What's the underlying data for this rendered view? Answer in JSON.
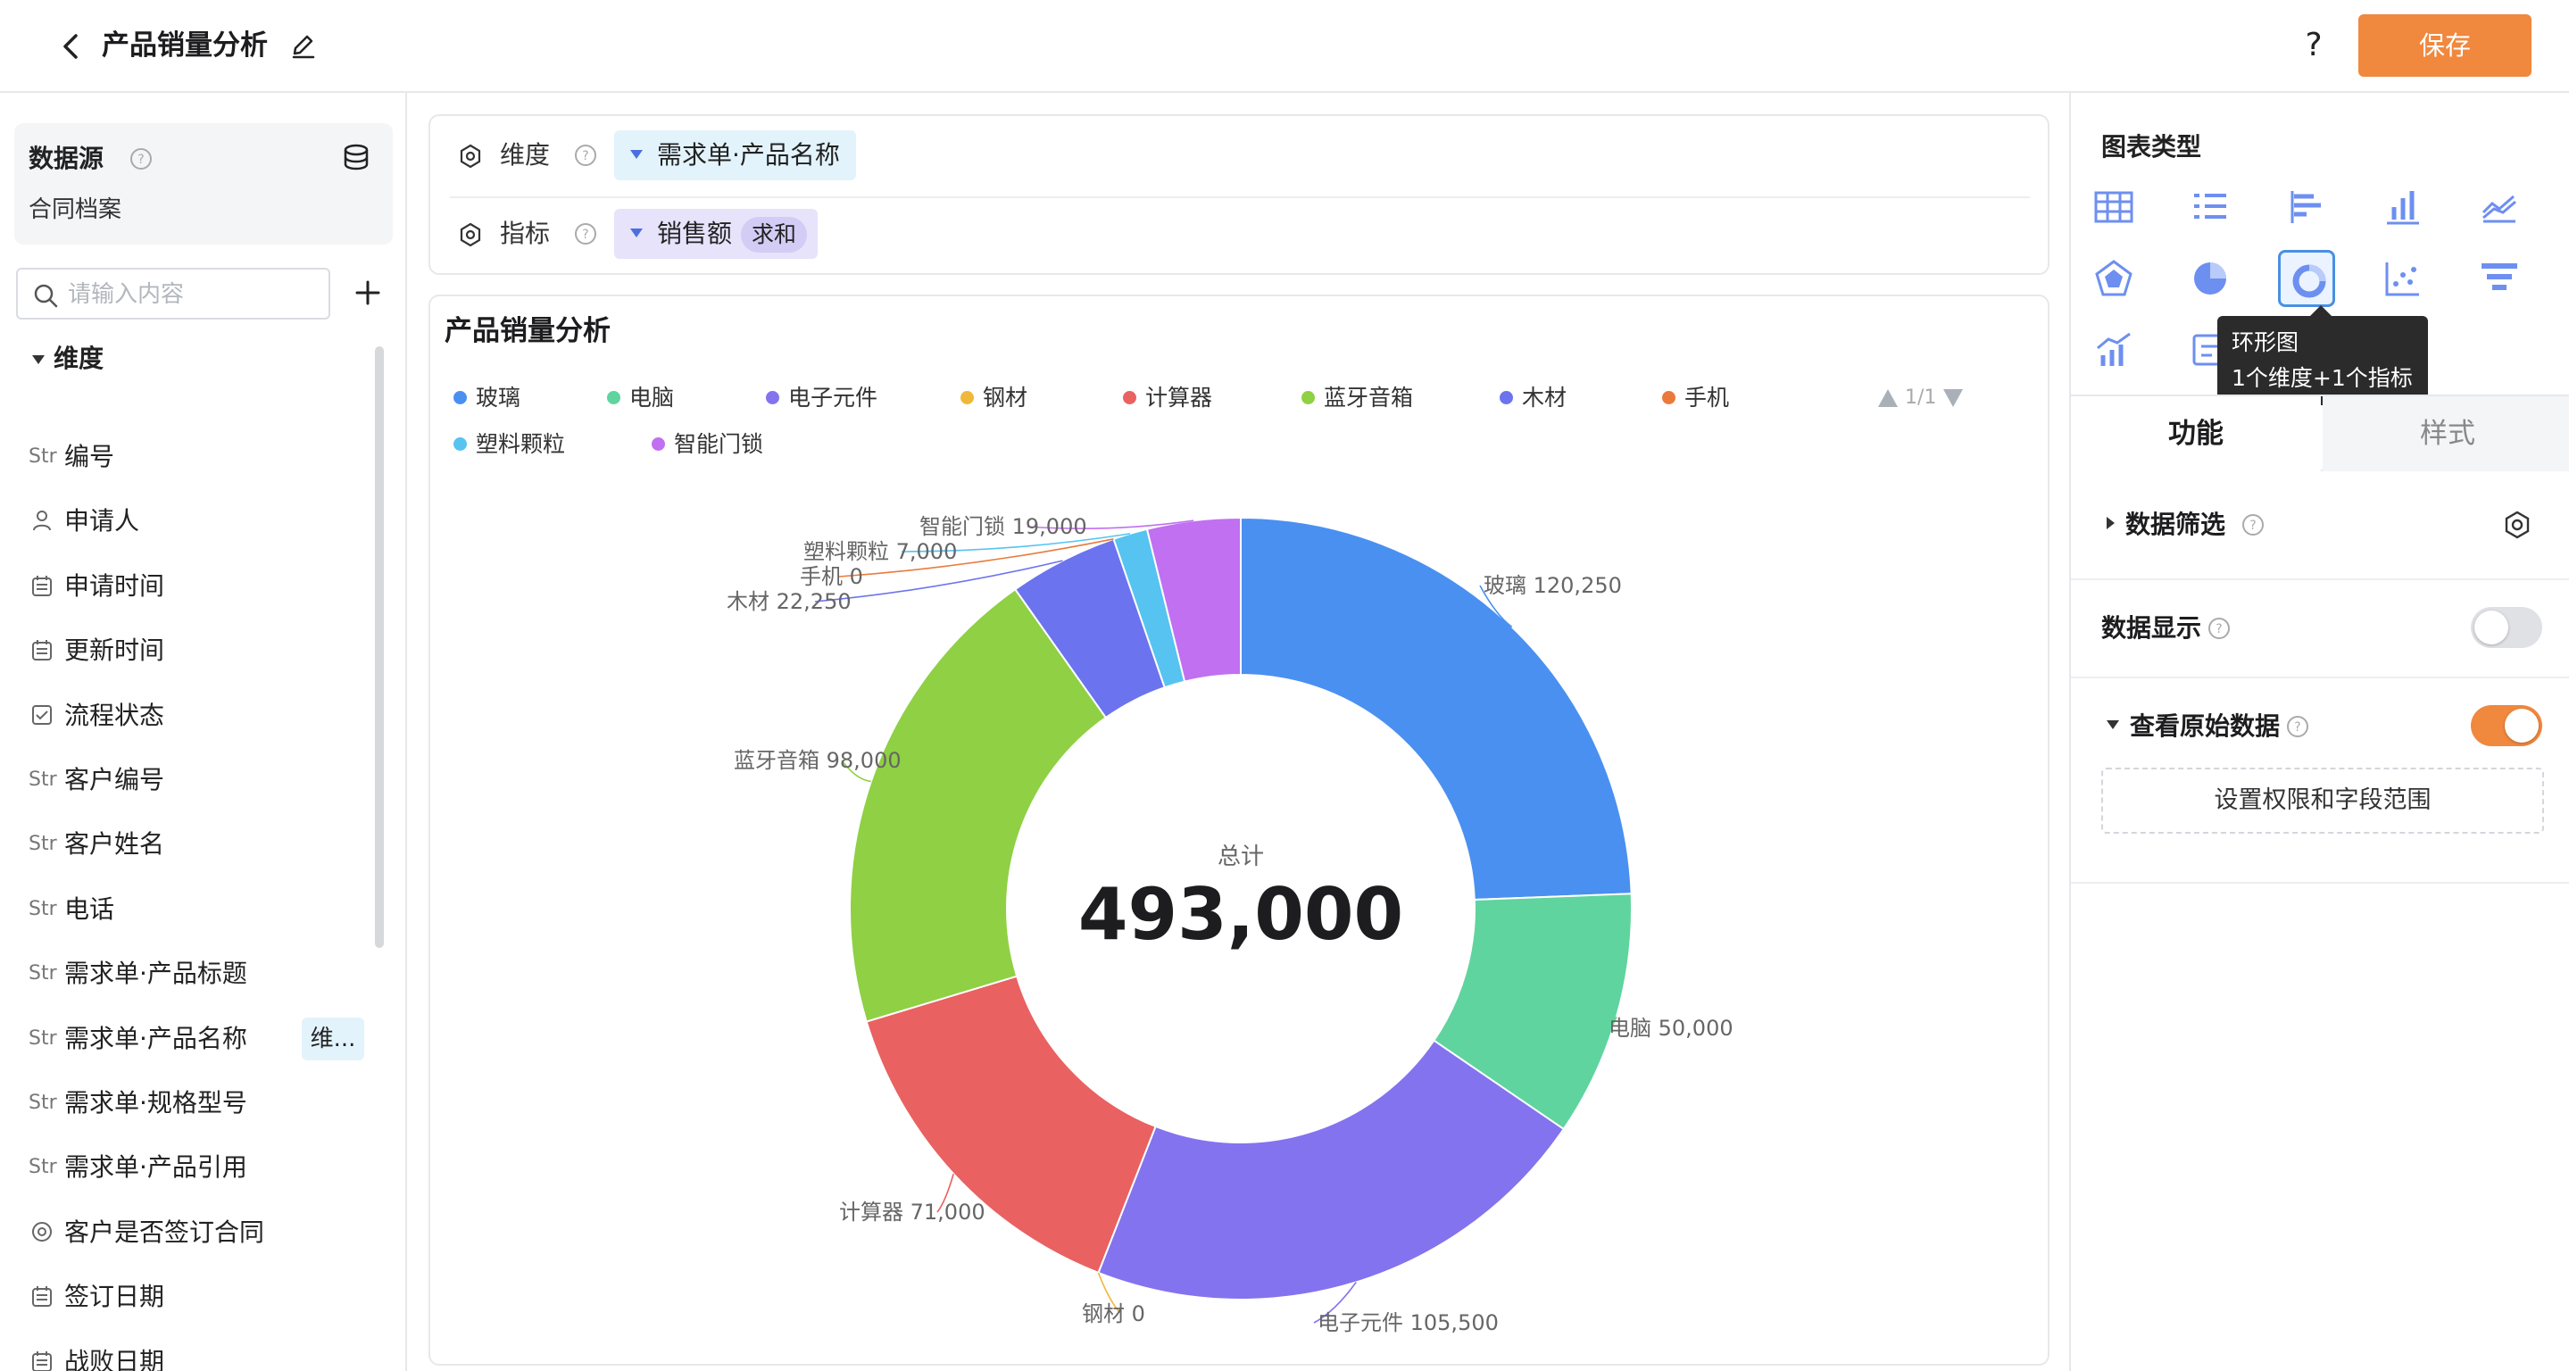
{
  "header": {
    "title": "产品销量分析",
    "help_label": "?",
    "save_label": "保存"
  },
  "datasource": {
    "title": "数据源",
    "name": "合同档案"
  },
  "search": {
    "placeholder": "请输入内容"
  },
  "dimension_group": {
    "title": "维度",
    "fields": [
      {
        "type": "Str",
        "icon": "text-type-icon",
        "label": "编号"
      },
      {
        "type": "user",
        "icon": "person-icon",
        "label": "申请人"
      },
      {
        "type": "date",
        "icon": "calendar-icon",
        "label": "申请时间"
      },
      {
        "type": "date",
        "icon": "calendar-icon",
        "label": "更新时间"
      },
      {
        "type": "check",
        "icon": "checkbox-icon",
        "label": "流程状态"
      },
      {
        "type": "Str",
        "icon": "text-type-icon",
        "label": "客户编号"
      },
      {
        "type": "Str",
        "icon": "text-type-icon",
        "label": "客户姓名"
      },
      {
        "type": "Str",
        "icon": "text-type-icon",
        "label": "电话"
      },
      {
        "type": "Str",
        "icon": "text-type-icon",
        "label": "需求单·产品标题"
      },
      {
        "type": "Str",
        "icon": "text-type-icon",
        "label": "需求单·产品名称",
        "tag": "维..."
      },
      {
        "type": "Str",
        "icon": "text-type-icon",
        "label": "需求单·规格型号"
      },
      {
        "type": "Str",
        "icon": "text-type-icon",
        "label": "需求单·产品引用"
      },
      {
        "type": "radio",
        "icon": "radio-icon",
        "label": "客户是否签订合同"
      },
      {
        "type": "date",
        "icon": "calendar-icon",
        "label": "签订日期"
      },
      {
        "type": "date",
        "icon": "calendar-icon",
        "label": "战败日期"
      }
    ]
  },
  "config": {
    "dimension_label": "维度",
    "dimension_value": "需求单·产品名称",
    "metric_label": "指标",
    "metric_value": "销售额",
    "metric_agg": "求和"
  },
  "chart_panel": {
    "title": "产品销量分析",
    "legend_page": "1/1"
  },
  "chart_data": {
    "type": "pie",
    "donut": true,
    "title": "产品销量分析",
    "center_label": "总计",
    "center_value": "493,000",
    "categories": [
      "玻璃",
      "电脑",
      "电子元件",
      "钢材",
      "计算器",
      "蓝牙音箱",
      "木材",
      "手机",
      "塑料颗粒",
      "智能门锁"
    ],
    "values": [
      120250,
      50000,
      105500,
      0,
      71000,
      98000,
      22250,
      0,
      7000,
      19000
    ],
    "data_labels": [
      "玻璃 120,250",
      "电脑 50,000",
      "电子元件 105,500",
      "钢材 0",
      "计算器 71,000",
      "蓝牙音箱 98,000",
      "木材 22,250",
      "手机 0",
      "塑料颗粒 7,000",
      "智能门锁 19,000"
    ],
    "colors": [
      "#4a90f0",
      "#5fd49e",
      "#8373ee",
      "#f0b83a",
      "#e96161",
      "#8fd044",
      "#6b73ee",
      "#ea7a3b",
      "#56c3f0",
      "#c070f0"
    ],
    "legend_position": "top"
  },
  "right_panel": {
    "chart_type_title": "图表类型",
    "chart_types": [
      {
        "name": "table",
        "icon": "table-icon"
      },
      {
        "name": "list",
        "icon": "list-icon"
      },
      {
        "name": "bar-horizontal",
        "icon": "bar-horizontal-icon"
      },
      {
        "name": "bar-vertical",
        "icon": "bar-vertical-icon"
      },
      {
        "name": "line",
        "icon": "line-chart-icon"
      },
      {
        "name": "radar",
        "icon": "radar-icon"
      },
      {
        "name": "pie",
        "icon": "pie-icon"
      },
      {
        "name": "donut",
        "icon": "donut-icon",
        "selected": true
      },
      {
        "name": "scatter",
        "icon": "scatter-icon"
      },
      {
        "name": "funnel",
        "icon": "funnel-icon"
      },
      {
        "name": "combo",
        "icon": "combo-chart-icon"
      },
      {
        "name": "indicator",
        "icon": "indicator-card-icon"
      },
      {
        "name": "map",
        "icon": "map-icon"
      },
      {
        "name": "tree",
        "icon": "tree-icon"
      }
    ],
    "tooltip_title": "环形图",
    "tooltip_desc": "1个维度+1个指标",
    "tab_function": "功能",
    "tab_style": "样式",
    "data_filter_label": "数据筛选",
    "data_display_label": "数据显示",
    "data_display_on": false,
    "raw_data_label": "查看原始数据",
    "raw_data_on": true,
    "permission_button": "设置权限和字段范围"
  }
}
